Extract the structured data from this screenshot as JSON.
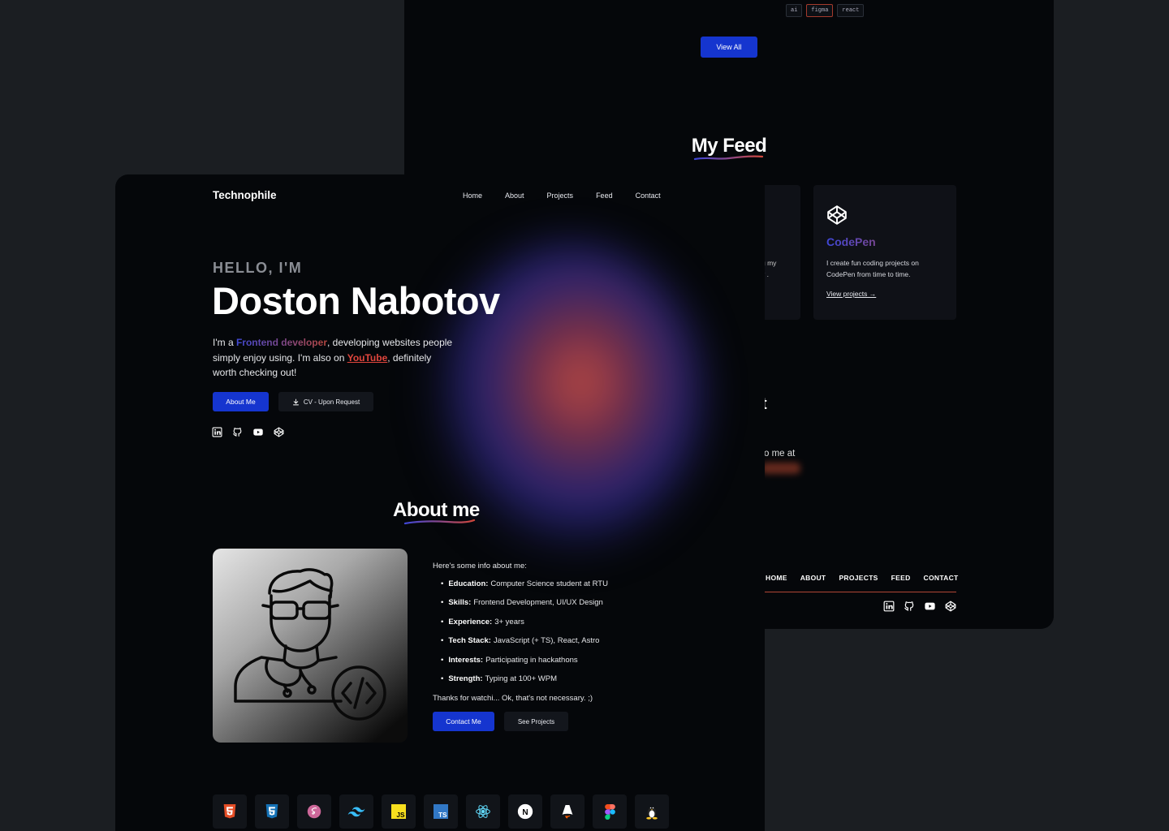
{
  "back_window": {
    "tags": [
      "ai",
      "figma",
      "react"
    ],
    "view_all_label": "View All",
    "feed_title": "My Feed",
    "partial_card_text": "g my\ny .",
    "codepen_card": {
      "icon": "codepen-icon",
      "title": "CodePen",
      "description": "I create fun coding projects on CodePen from time to time.",
      "link": "View projects →"
    },
    "fragment_heading": "t",
    "fragment_text": "o me at",
    "footer_nav": [
      "HOME",
      "ABOUT",
      "PROJECTS",
      "FEED",
      "CONTACT"
    ],
    "footer_social": [
      "linkedin-icon",
      "github-icon",
      "youtube-icon",
      "codepen-icon"
    ]
  },
  "front_window": {
    "brand": "Technophile",
    "nav": [
      "Home",
      "About",
      "Projects",
      "Feed",
      "Contact"
    ],
    "hero": {
      "greeting": "HELLO, I'M",
      "name": "Doston Nabotov",
      "intro_prefix": "I'm a ",
      "role": "Frontend developer",
      "intro_mid": ", developing websites people simply enjoy using. I'm also on ",
      "youtube": "YouTube",
      "intro_suffix": ", definitely worth checking out!",
      "about_button": "About Me",
      "cv_button": "CV - Upon Request",
      "social": [
        "linkedin-icon",
        "github-icon",
        "youtube-icon",
        "codepen-icon"
      ]
    },
    "about": {
      "title": "About me",
      "intro": "Here's some info about me:",
      "items": [
        {
          "label": "Education:",
          "value": "Computer Science student at RTU"
        },
        {
          "label": "Skills:",
          "value": "Frontend Development, UI/UX Design"
        },
        {
          "label": "Experience:",
          "value": "3+ years"
        },
        {
          "label": "Tech Stack:",
          "value": "JavaScript (+ TS), React, Astro"
        },
        {
          "label": "Interests:",
          "value": "Participating in hackathons"
        },
        {
          "label": "Strength:",
          "value": "Typing at 100+ WPM"
        }
      ],
      "thanks": "Thanks for watchi... Ok, that's not necessary. ;)",
      "contact_button": "Contact Me",
      "projects_button": "See Projects"
    },
    "tech_icons": [
      "html5-icon",
      "css3-icon",
      "sass-icon",
      "tailwind-icon",
      "javascript-icon",
      "typescript-icon",
      "react-icon",
      "nextjs-icon",
      "astro-icon",
      "figma-icon",
      "linux-icon"
    ],
    "tech_labels": {
      "js": "JS",
      "ts": "TS",
      "next": "N"
    }
  },
  "colors": {
    "accent_blue": "#1535cf",
    "accent_red": "#e2463d",
    "background": "#05070a",
    "page_background": "#1b1e22"
  }
}
